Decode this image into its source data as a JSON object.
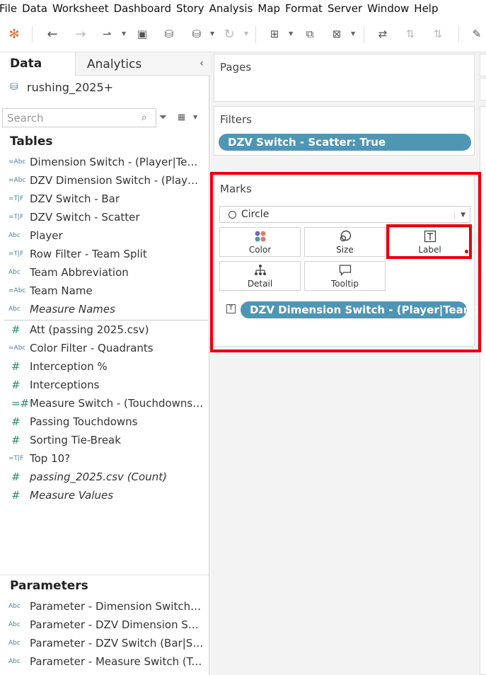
{
  "menu": [
    "File",
    "Data",
    "Worksheet",
    "Dashboard",
    "Story",
    "Analysis",
    "Map",
    "Format",
    "Server",
    "Window",
    "Help"
  ],
  "left_panel": {
    "tabs": {
      "data": "Data",
      "analytics": "Analytics"
    },
    "datasource": "rushing_2025+",
    "search_placeholder": "Search",
    "tables_title": "Tables",
    "dimensions": [
      {
        "icon": "=Abc",
        "name": "Dimension Switch - (Player|Team)"
      },
      {
        "icon": "=Abc",
        "name": "DZV Dimension Switch - (Player|T..."
      },
      {
        "icon": "=T|F",
        "name": "DZV Switch - Bar"
      },
      {
        "icon": "=T|F",
        "name": "DZV Switch - Scatter"
      },
      {
        "icon": "Abc",
        "name": "Player"
      },
      {
        "icon": "=T|F",
        "name": "Row Filter - Team Split"
      },
      {
        "icon": "Abc",
        "name": "Team Abbreviation"
      },
      {
        "icon": "=Abc",
        "name": "Team Name"
      },
      {
        "icon": "Abc",
        "name": "Measure Names",
        "italic": true
      }
    ],
    "measures": [
      {
        "icon": "#",
        "name": "Att (passing 2025.csv)"
      },
      {
        "icon": "=Abc",
        "name": "Color Filter - Quadrants"
      },
      {
        "icon": "#",
        "name": "Interception %"
      },
      {
        "icon": "#",
        "name": "Interceptions"
      },
      {
        "icon": "=#",
        "name": "Measure Switch - (Touchdowns|I..."
      },
      {
        "icon": "#",
        "name": "Passing Touchdowns"
      },
      {
        "icon": "#",
        "name": "Sorting Tie-Break"
      },
      {
        "icon": "=T|F",
        "name": "Top 10?"
      },
      {
        "icon": "#",
        "name": "passing_2025.csv (Count)",
        "italic": true
      },
      {
        "icon": "#",
        "name": "Measure Values",
        "italic": true
      }
    ],
    "parameters_title": "Parameters",
    "parameters": [
      {
        "icon": "Abc",
        "name": "Parameter - Dimension Switch (Pl..."
      },
      {
        "icon": "Abc",
        "name": "Parameter - DZV Dimension Swit..."
      },
      {
        "icon": "Abc",
        "name": "Parameter - DZV Switch (Bar|Sca..."
      },
      {
        "icon": "Abc",
        "name": "Parameter - Measure Switch (Tou..."
      }
    ]
  },
  "shelves": {
    "pages_title": "Pages",
    "filters_title": "Filters",
    "filter_pill": "DZV Switch - Scatter: True",
    "marks_title": "Marks",
    "mark_type": "Circle",
    "buttons": {
      "color": "Color",
      "size": "Size",
      "label": "Label",
      "detail": "Detail",
      "tooltip": "Tooltip"
    },
    "label_field_icon": "T",
    "label_pill": "DZV Dimension Switch - (Player|Team)"
  },
  "colors": {
    "pill": "#4e96b4",
    "highlight": "#e8000b",
    "measure_icon": "#2e8b6e",
    "dimension_icon": "#4a7fa5"
  }
}
